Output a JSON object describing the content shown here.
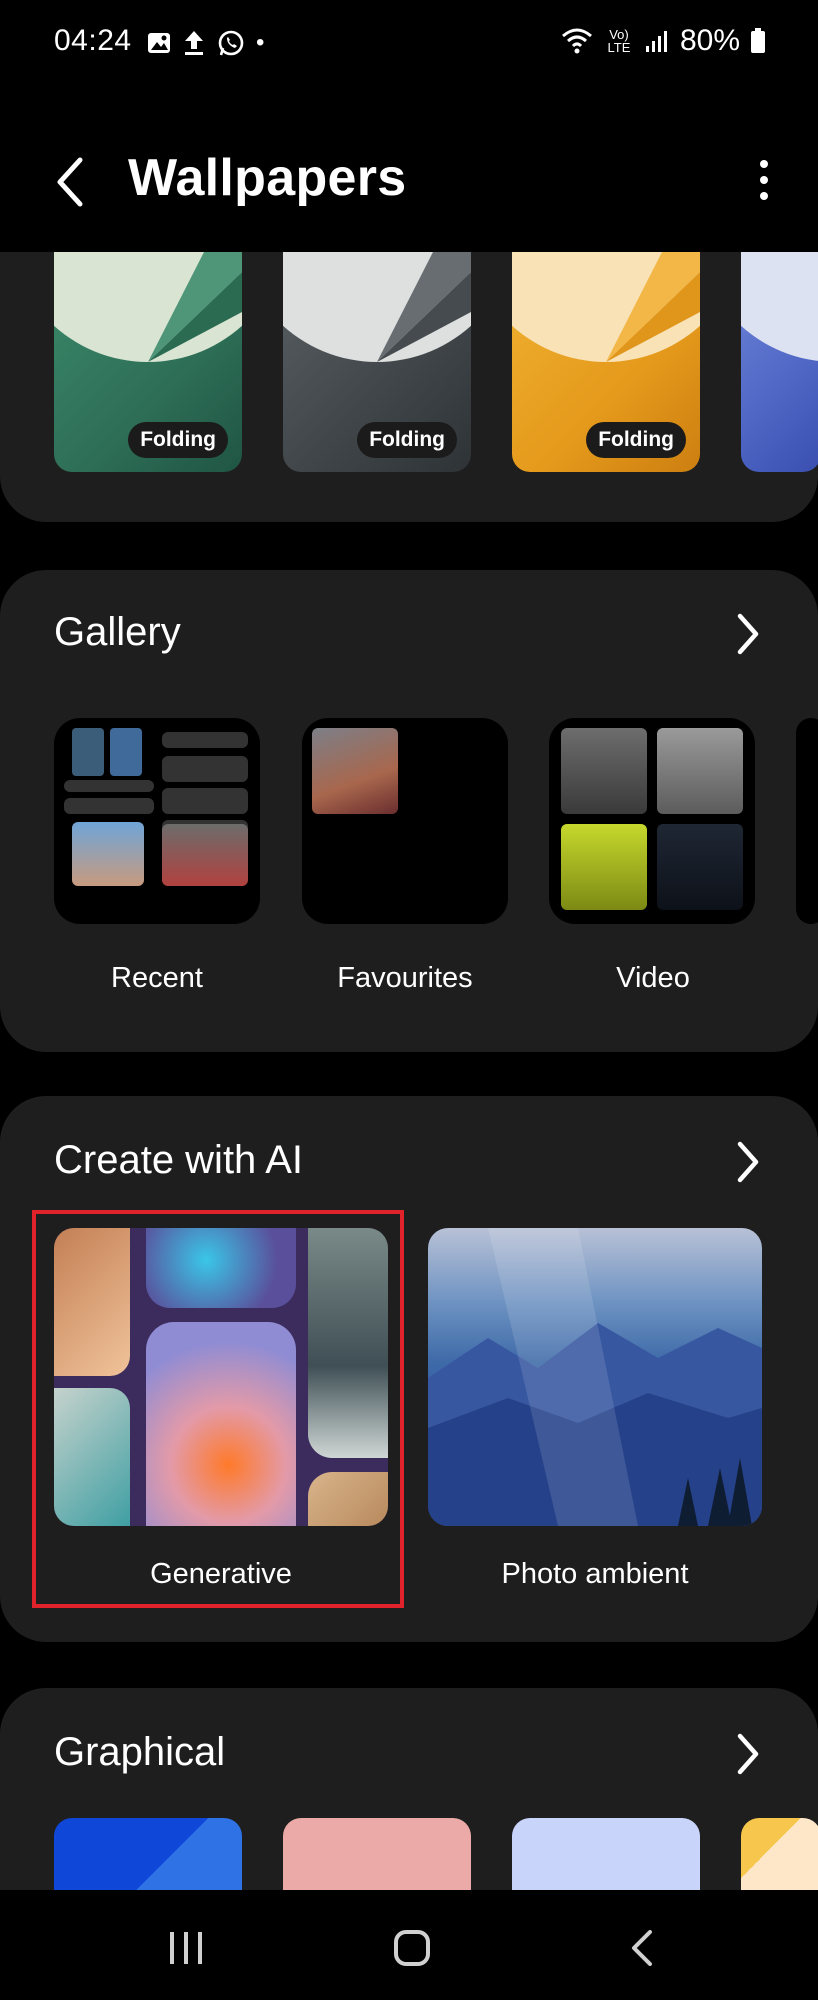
{
  "status_bar": {
    "time": "04:24",
    "battery": "80%",
    "network": "Vo) LTE",
    "dot": "•"
  },
  "header": {
    "title": "Wallpapers"
  },
  "folding": {
    "items": [
      {
        "badge": "Folding",
        "color": "#2e6e57"
      },
      {
        "badge": "Folding",
        "color": "#3f4548"
      },
      {
        "badge": "Folding",
        "color": "#e59a1c"
      }
    ]
  },
  "gallery": {
    "title": "Gallery",
    "albums": [
      {
        "label": "Recent"
      },
      {
        "label": "Favourites"
      },
      {
        "label": "Video"
      }
    ]
  },
  "ai": {
    "title": "Create with AI",
    "items": [
      {
        "label": "Generative"
      },
      {
        "label": "Photo ambient"
      }
    ],
    "highlight_color": "#e0232b"
  },
  "graphical": {
    "title": "Graphical",
    "colors": [
      "#1f5be0",
      "#ebaaa8",
      "#c9d4fb",
      "#fde7c8"
    ]
  },
  "colors": {
    "background": "#000000",
    "card": "#1e1e1e"
  }
}
